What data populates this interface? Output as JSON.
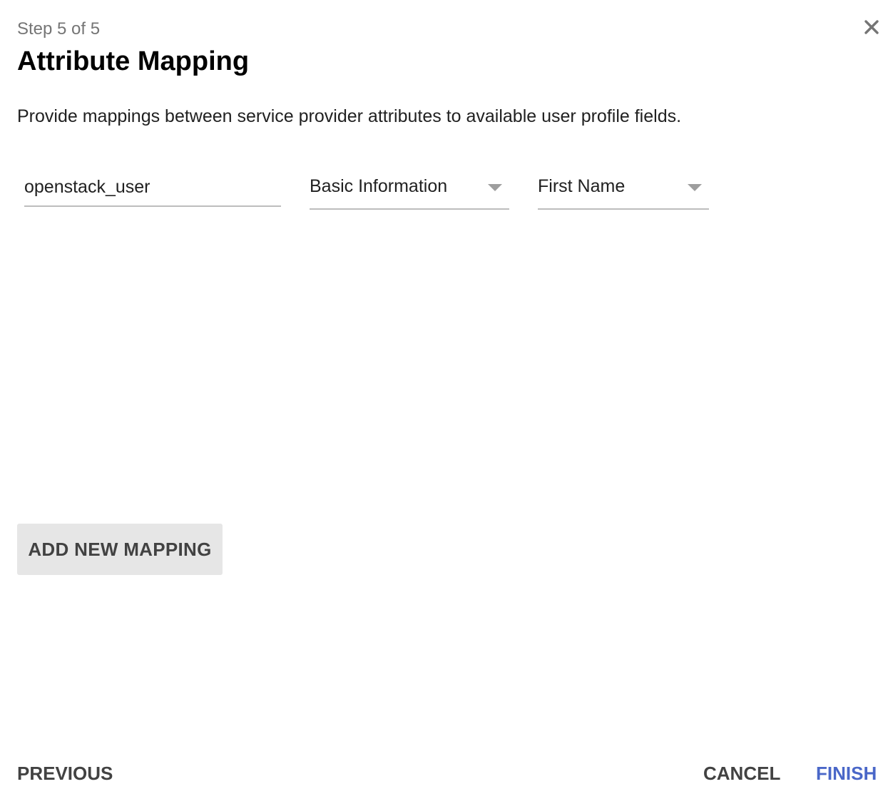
{
  "dialog": {
    "step_label": "Step 5 of 5",
    "title": "Attribute Mapping",
    "close_icon": "close-icon",
    "description": "Provide mappings between service provider attributes to available user profile fields."
  },
  "mapping": {
    "attribute_value": "openstack_user",
    "category_selected": "Basic Information",
    "field_selected": "First Name"
  },
  "actions": {
    "add_mapping_label": "ADD NEW MAPPING",
    "previous_label": "PREVIOUS",
    "cancel_label": "CANCEL",
    "finish_label": "FINISH"
  },
  "colors": {
    "accent": "#4a67c8",
    "secondary_button_bg": "#e6e6e6",
    "muted_text": "#757575"
  }
}
